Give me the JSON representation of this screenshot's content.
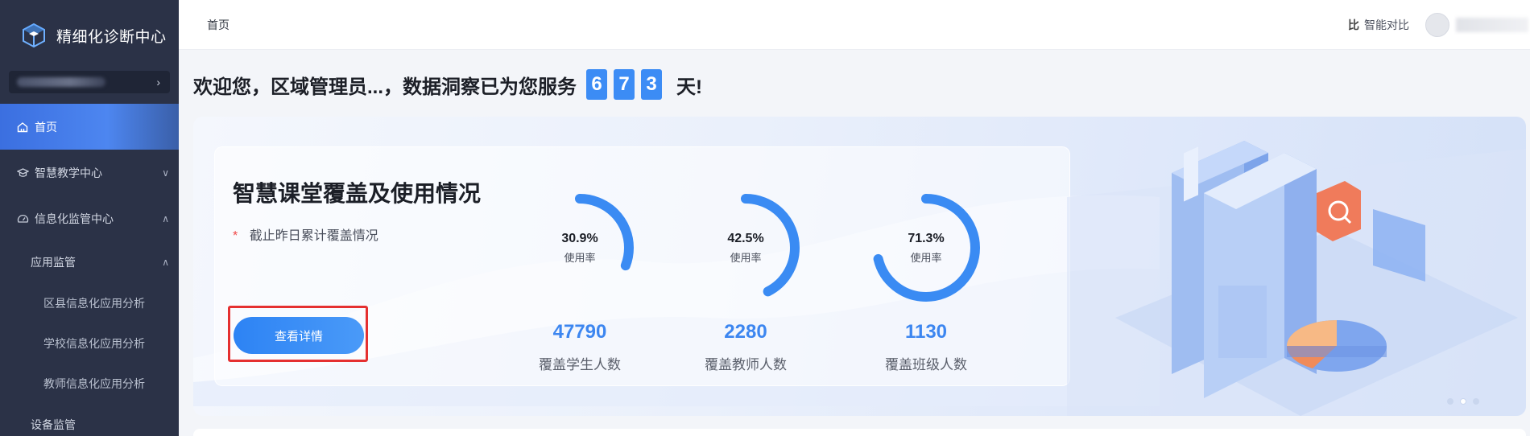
{
  "sidebar": {
    "brand_title": "精细化诊断中心",
    "org_chevron": "›",
    "items": [
      {
        "label": "首页"
      },
      {
        "label": "智慧教学中心",
        "arrow": "∨"
      },
      {
        "label": "信息化监管中心",
        "arrow": "∧"
      }
    ],
    "sub_app": {
      "label": "应用监管",
      "arrow": "∧"
    },
    "leaves": [
      {
        "label": "区县信息化应用分析"
      },
      {
        "label": "学校信息化应用分析"
      },
      {
        "label": "教师信息化应用分析"
      }
    ],
    "sub_device": {
      "label": "设备监管"
    }
  },
  "header": {
    "breadcrumb": "首页",
    "compare_label": "智能对比",
    "compare_icon": "比"
  },
  "welcome": {
    "text": "欢迎您，区域管理员...，数据洞察已为您服务",
    "digits": [
      "6",
      "7",
      "3"
    ],
    "suffix": "天!"
  },
  "card": {
    "title": "智慧课堂覆盖及使用情况",
    "star": "*",
    "subtitle": "截止昨日累计覆盖情况",
    "detail_button": "查看详情"
  },
  "stats": [
    {
      "percent_text": "30.9%",
      "percent": 30.9,
      "caption": "使用率",
      "value": "47790",
      "label": "覆盖学生人数"
    },
    {
      "percent_text": "42.5%",
      "percent": 42.5,
      "caption": "使用率",
      "value": "2280",
      "label": "覆盖教师人数"
    },
    {
      "percent_text": "71.3%",
      "percent": 71.3,
      "caption": "使用率",
      "value": "1130",
      "label": "覆盖班级人数"
    }
  ],
  "carousel": {
    "count": 3,
    "active_index": 1
  },
  "colors": {
    "accent": "#3c8cf5",
    "sidebar_bg": "#2b3247",
    "highlight": "#e53030"
  }
}
